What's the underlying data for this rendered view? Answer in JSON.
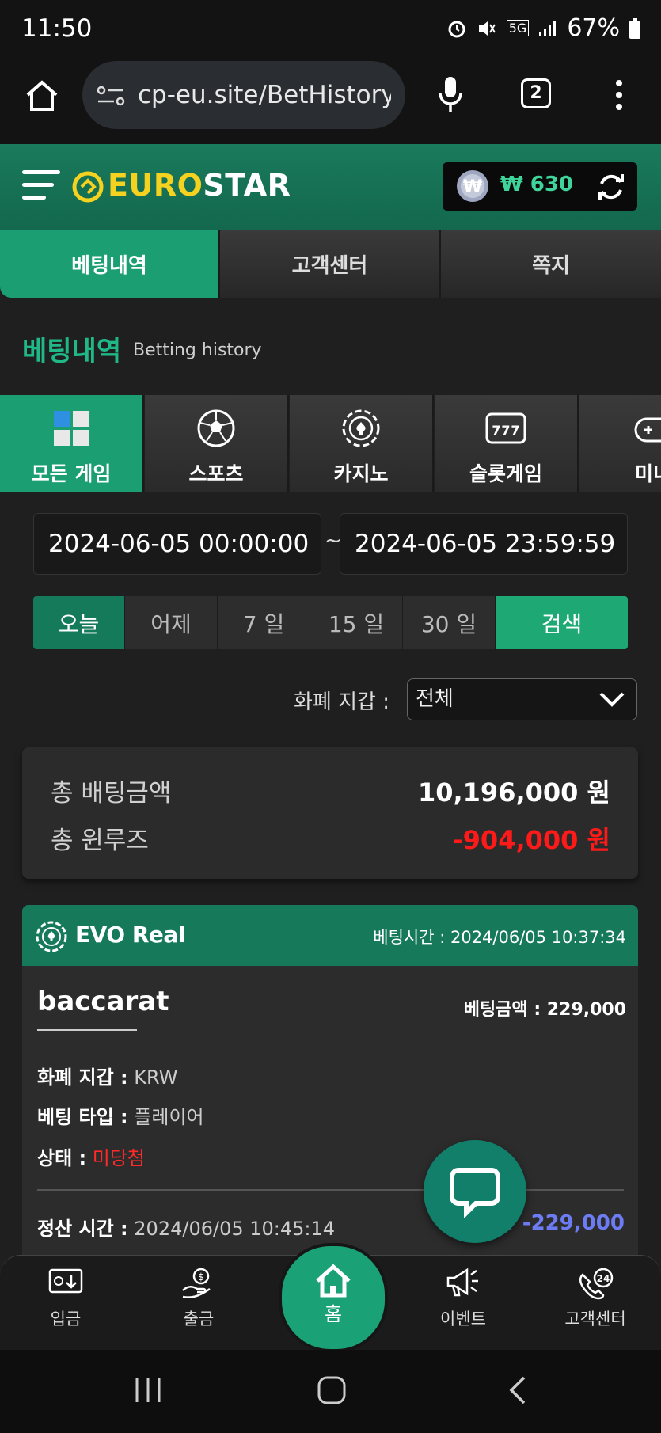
{
  "status_bar": {
    "time": "11:50",
    "battery": "67%"
  },
  "browser": {
    "url": "cp-eu.site/BetHistory",
    "tab_count": "2"
  },
  "header": {
    "logo_left": "EURO",
    "logo_right": "STAR",
    "balance": "₩ 630"
  },
  "top_tabs": [
    {
      "label": "베팅내역",
      "active": true
    },
    {
      "label": "고객센터",
      "active": false
    },
    {
      "label": "쪽지",
      "active": false
    }
  ],
  "page_title": {
    "ko": "베팅내역",
    "en": "Betting history"
  },
  "game_tabs": [
    {
      "label": "모든 게임",
      "icon": "cubes-icon",
      "active": true
    },
    {
      "label": "스포츠",
      "icon": "soccer-ball-icon",
      "active": false
    },
    {
      "label": "카지노",
      "icon": "casino-chip-icon",
      "active": false
    },
    {
      "label": "슬롯게임",
      "icon": "slot-machine-icon",
      "active": false
    },
    {
      "label": "미니",
      "icon": "gamepad-icon",
      "active": false
    }
  ],
  "date_range": {
    "start": "2024-06-05 00:00:00",
    "separator": "~",
    "end": "2024-06-05 23:59:59"
  },
  "quick_ranges": [
    {
      "label": "오늘",
      "active": true
    },
    {
      "label": "어제",
      "active": false
    },
    {
      "label": "7 일",
      "active": false
    },
    {
      "label": "15 일",
      "active": false
    },
    {
      "label": "30 일",
      "active": false
    }
  ],
  "search_label": "검색",
  "wallet_filter": {
    "label": "화폐 지갑 :",
    "value": "전체"
  },
  "summary": {
    "total_bet_label": "총 배팅금액",
    "total_bet_value": "10,196,000 원",
    "total_winloss_label": "총 윈루즈",
    "total_winloss_value": "-904,000 원"
  },
  "bet_card": {
    "provider": "EVO Real",
    "bet_time_label": "베팅시간 :",
    "bet_time": "2024/06/05 10:37:34",
    "game": "baccarat",
    "bet_amount_label": "베팅금액 :",
    "bet_amount": "229,000",
    "wallet_label": "화폐 지갑 :",
    "wallet": "KRW",
    "bet_type_label": "베팅 타입 :",
    "bet_type": "플레이어",
    "status_label": "상태 :",
    "status": "미당첨",
    "settle_label": "정산 시간 :",
    "settle_time": "2024/06/05 10:45:14",
    "settle_amount": "₩ -229,000"
  },
  "bottom_nav": [
    {
      "label": "입금",
      "icon": "deposit-icon"
    },
    {
      "label": "출금",
      "icon": "withdraw-icon"
    },
    {
      "label": "홈",
      "icon": "home-icon"
    },
    {
      "label": "이벤트",
      "icon": "megaphone-icon"
    },
    {
      "label": "고객센터",
      "icon": "support-24-icon"
    }
  ],
  "colors": {
    "accent": "#1a9e72",
    "header": "#167a5a",
    "loss": "#ff1a1a",
    "settle": "#6d7cf5",
    "logo_yellow": "#f4d21f"
  }
}
